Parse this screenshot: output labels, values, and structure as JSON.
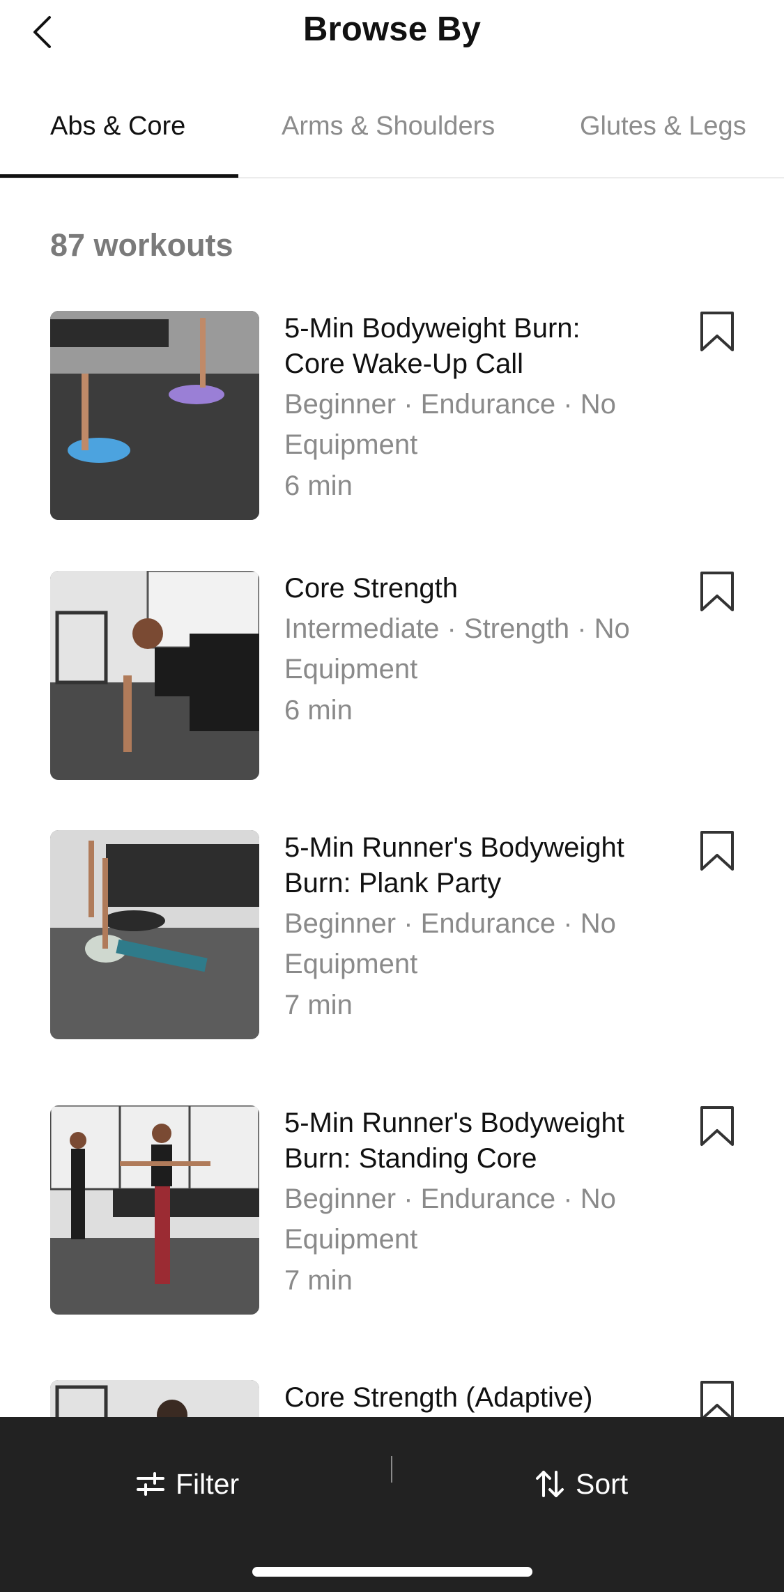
{
  "header": {
    "title": "Browse By",
    "back_icon": "chevron-left-icon"
  },
  "tabs": [
    {
      "label": "Abs & Core",
      "active": true
    },
    {
      "label": "Arms & Shoulders",
      "active": false
    },
    {
      "label": "Glutes & Legs",
      "active": false
    }
  ],
  "count_text": "87 workouts",
  "workouts": [
    {
      "title": "5-Min Bodyweight Burn: Core Wake-Up Call",
      "meta": "Beginner · Endurance · No Equipment",
      "duration": "6 min",
      "bookmark_icon": "bookmark-icon"
    },
    {
      "title": "Core Strength",
      "meta": "Intermediate · Strength · No Equipment",
      "duration": "6 min",
      "bookmark_icon": "bookmark-icon"
    },
    {
      "title": "5-Min Runner's Bodyweight Burn: Plank Party",
      "meta": "Beginner · Endurance · No Equipment",
      "duration": "7 min",
      "bookmark_icon": "bookmark-icon"
    },
    {
      "title": "5-Min Runner's Bodyweight Burn: Standing Core",
      "meta": "Beginner · Endurance · No Equipment",
      "duration": "7 min",
      "bookmark_icon": "bookmark-icon"
    },
    {
      "title": "Core Strength (Adaptive)",
      "meta": "",
      "duration": "",
      "bookmark_icon": "bookmark-icon"
    }
  ],
  "bottom_bar": {
    "filter_label": "Filter",
    "filter_icon": "sliders-icon",
    "sort_label": "Sort",
    "sort_icon": "sort-arrows-icon"
  },
  "colors": {
    "accent": "#111111",
    "muted_text": "#8a8a8a",
    "bottom_bar_bg": "#222222"
  }
}
